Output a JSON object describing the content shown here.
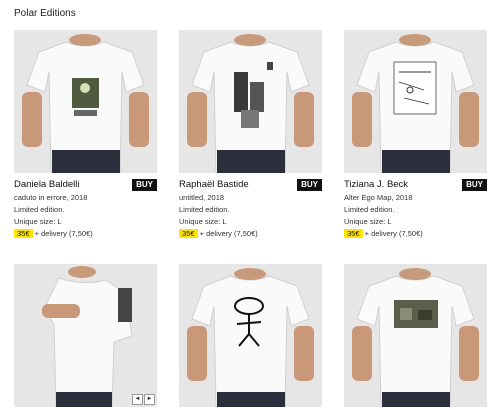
{
  "header": {
    "title": "Polar Editions"
  },
  "products": [
    {
      "artist": "Daniela Baldelli",
      "work": "caduto in errore, 2018",
      "edition": "Limited edition.",
      "size": "Unique size: L",
      "price": "35€",
      "delivery": "+ delivery (7,50€)",
      "buy": "BUY"
    },
    {
      "artist": "Raphaël Bastide",
      "work": "untitled, 2018",
      "edition": "Limited edition.",
      "size": "Unique size: L",
      "price": "35€",
      "delivery": "+ delivery (7,50€)",
      "buy": "BUY"
    },
    {
      "artist": "Tiziana J. Beck",
      "work": "Alter Ego Map, 2018",
      "edition": "Limited edition.",
      "size": "Unique size: L",
      "price": "35€",
      "delivery": "+ delivery (7,50€)",
      "buy": "BUY"
    }
  ],
  "gallery_nav": {
    "prev": "◄",
    "next": "►"
  },
  "colors": {
    "price_highlight": "#ffe600",
    "buy_button": "#111111",
    "photo_bg": "#e4e4e4"
  }
}
